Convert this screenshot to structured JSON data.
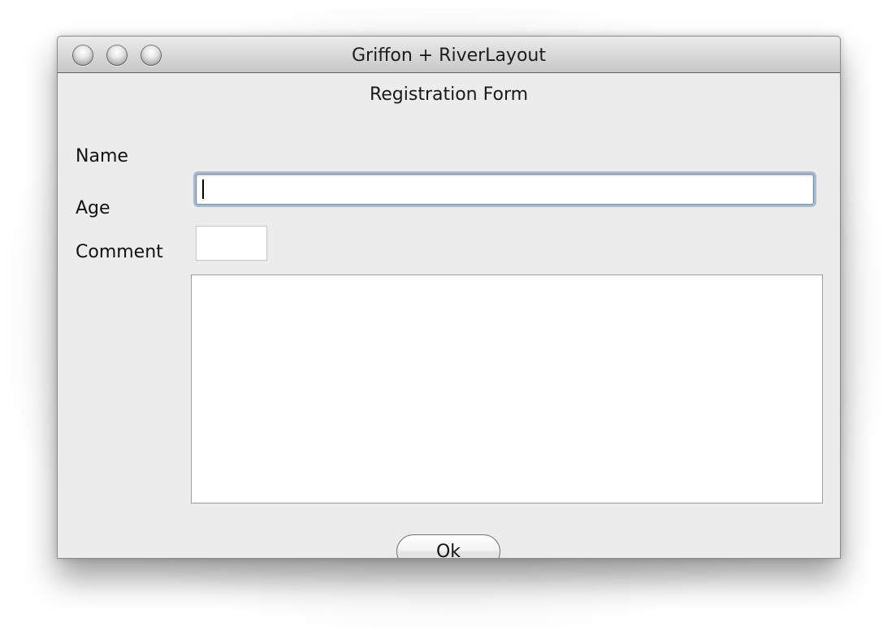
{
  "window": {
    "title": "Griffon + RiverLayout"
  },
  "form": {
    "title": "Registration Form",
    "name_label": "Name",
    "name_value": "",
    "age_label": "Age",
    "age_value": "",
    "comment_label": "Comment",
    "comment_value": "",
    "ok_label": "Ok"
  },
  "icons": {
    "close": "traffic-light-close",
    "minimize": "traffic-light-minimize",
    "zoom": "traffic-light-zoom"
  }
}
